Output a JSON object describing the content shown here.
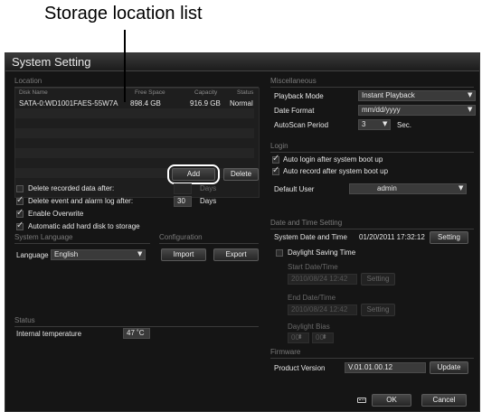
{
  "callout": {
    "label": "Storage location list"
  },
  "window": {
    "title": "System Setting"
  },
  "location": {
    "section": "Location",
    "columns": [
      "Disk Name",
      "Free Space",
      "Capacity",
      "Status"
    ],
    "rows": [
      {
        "disk": "SATA-0:WD1001FAES-55W7A",
        "free": "898.4 GB",
        "capacity": "916.9 GB",
        "status": "Normal"
      }
    ],
    "add_label": "Add",
    "delete_label": "Delete"
  },
  "options": {
    "delete_recorded": {
      "label": "Delete recorded data after:",
      "checked": false,
      "value": "",
      "unit": "Days"
    },
    "delete_event": {
      "label": "Delete event and alarm log after:",
      "checked": true,
      "value": "30",
      "unit": "Days"
    },
    "enable_overwrite": {
      "label": "Enable Overwrite",
      "checked": true
    },
    "auto_add": {
      "label": "Automatic add hard disk to storage",
      "checked": true
    }
  },
  "system_language": {
    "section": "System Language",
    "label": "Language",
    "value": "English"
  },
  "configuration": {
    "section": "Configuration",
    "import_label": "Import",
    "export_label": "Export"
  },
  "status": {
    "section": "Status",
    "temp_label": "Internal temperature",
    "temp_value": "47 ˚C"
  },
  "misc": {
    "section": "Miscellaneous",
    "playback_label": "Playback Mode",
    "playback_value": "Instant Playback",
    "date_label": "Date Format",
    "date_value": "mm/dd/yyyy",
    "autoscan_label": "AutoScan Period",
    "autoscan_value": "3",
    "autoscan_unit": "Sec."
  },
  "login": {
    "section": "Login",
    "auto_login": "Auto login after system boot up",
    "auto_record": "Auto record after system boot up",
    "default_user_label": "Default User",
    "default_user_value": "admin"
  },
  "datetime": {
    "section": "Date and Time Setting",
    "system_label": "System Date and Time",
    "system_value": "01/20/2011 17:32:12",
    "setting_label": "Setting",
    "dst_label": "Daylight Saving Time",
    "start_label": "Start Date/Time",
    "start_value": "2010/08/24 12:42",
    "end_label": "End Date/Time",
    "end_value": "2010/08/24 12:42",
    "bias_label": "Daylight Bias",
    "bias_hours": "00",
    "bias_minutes": "00"
  },
  "firmware": {
    "section": "Firmware",
    "version_label": "Product Version",
    "version_value": "V.01.01.00.12",
    "update_label": "Update"
  },
  "footer": {
    "ok_label": "OK",
    "cancel_label": "Cancel"
  },
  "icons": {
    "dropdown": "dropdown-arrow-icon",
    "keyboard": "keyboard-icon",
    "check": "checkmark-icon"
  }
}
